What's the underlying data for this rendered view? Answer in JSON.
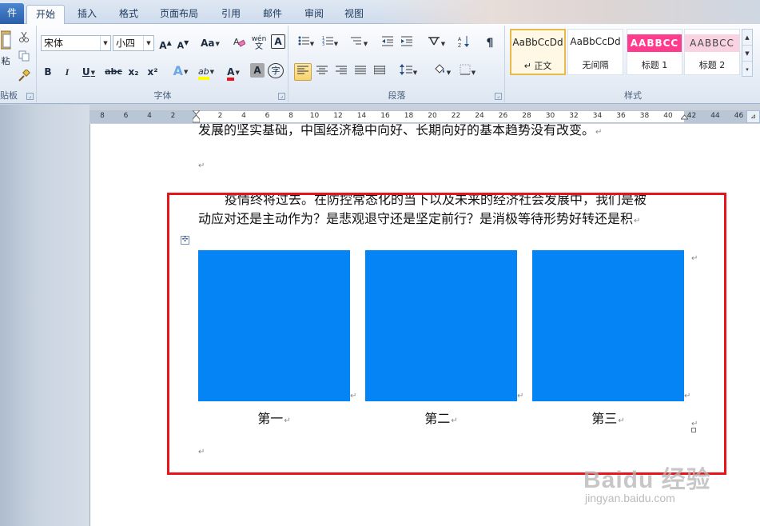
{
  "tabs": [
    {
      "id": "file",
      "label": "件"
    },
    {
      "id": "home",
      "label": "开始"
    },
    {
      "id": "insert",
      "label": "插入"
    },
    {
      "id": "format",
      "label": "格式"
    },
    {
      "id": "layout",
      "label": "页面布局"
    },
    {
      "id": "references",
      "label": "引用"
    },
    {
      "id": "mailings",
      "label": "邮件"
    },
    {
      "id": "review",
      "label": "审阅"
    },
    {
      "id": "view",
      "label": "视图"
    }
  ],
  "ribbon": {
    "clipboard": {
      "paste_label": "粘",
      "group_label": "贴板"
    },
    "font": {
      "font_name": "宋体",
      "font_size": "小四",
      "grow": "A",
      "shrink": "A",
      "change_case": "Aa",
      "wen": "wén",
      "char_border": "A",
      "bold": "B",
      "italic": "I",
      "underline": "U",
      "strike": "abc",
      "subscript": "x₂",
      "superscript": "x²",
      "text_effect": "A",
      "highlight": "ab",
      "font_color": "A",
      "char_shading": "A",
      "enclose": "字",
      "group_label": "字体"
    },
    "paragraph": {
      "group_label": "段落"
    },
    "styles": {
      "group_label": "样式",
      "items": [
        {
          "sample": "AaBbCcDd",
          "name": "↵ 正文"
        },
        {
          "sample": "AaBbCcDd",
          "name": "无间隔"
        },
        {
          "sample": "AABBCC",
          "name": "标题 1"
        },
        {
          "sample": "AABBCC",
          "name": "标题 2"
        }
      ]
    }
  },
  "ruler": {
    "ticks": [
      "8",
      "6",
      "4",
      "2",
      "",
      "2",
      "4",
      "6",
      "8",
      "10",
      "12",
      "14",
      "16",
      "18",
      "20",
      "22",
      "24",
      "26",
      "28",
      "30",
      "32",
      "34",
      "36",
      "38",
      "40",
      "42",
      "44",
      "46",
      "48"
    ]
  },
  "document": {
    "line_top": "发展的坚实基础，中国经济稳中向好、长期向好的基本趋势没有改变。",
    "para1_line1": "疫情终将过去。在防控常态化的当下以及未来的经济社会发展中，我们是被",
    "para1_line2": "动应对还是主动作为？是悲观退守还是坚定前行？是消极等待形势好转还是积",
    "para_mark": "↵",
    "table_move_glyph": "✣",
    "captions": [
      "第一",
      "第二",
      "第三"
    ],
    "image_color": "#0585f5"
  },
  "annotation": {
    "box_color": "#e8141a"
  },
  "watermark": {
    "main": "Baidu 经验",
    "sub": "jingyan.baidu.com"
  }
}
